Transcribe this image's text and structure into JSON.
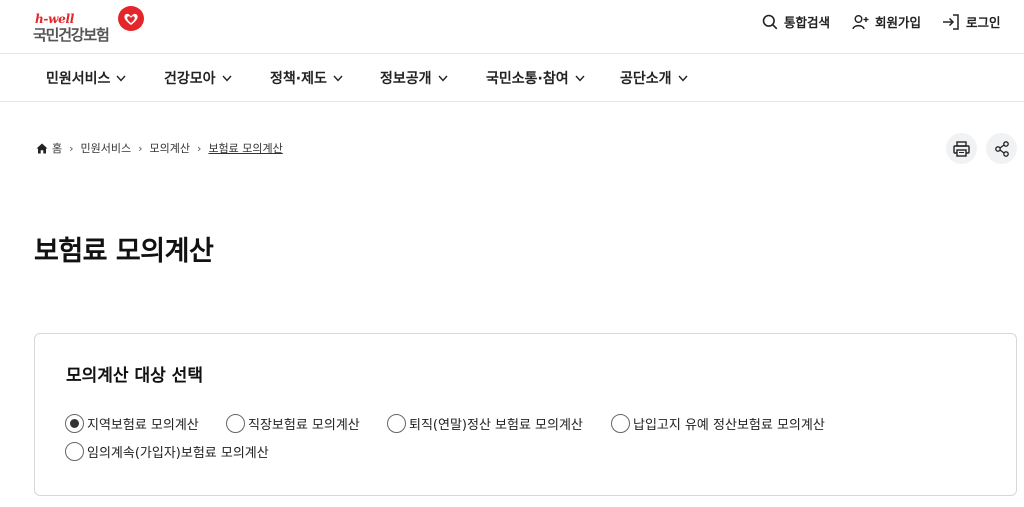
{
  "header": {
    "logo_tagline": "h-well",
    "logo_name": "국민건강보험",
    "search_label": "통합검색",
    "join_label": "회원가입",
    "login_label": "로그인"
  },
  "nav": {
    "items": [
      {
        "label": "민원서비스"
      },
      {
        "label": "건강모아"
      },
      {
        "label": "정책·제도"
      },
      {
        "label": "정보공개"
      },
      {
        "label": "국민소통·참여"
      },
      {
        "label": "공단소개"
      }
    ]
  },
  "breadcrumb": {
    "home": "홈",
    "level1": "민원서비스",
    "level2": "모의계산",
    "current": "보험료 모의계산"
  },
  "page": {
    "title": "보험료 모의계산"
  },
  "selection": {
    "title": "모의계산 대상 선택",
    "options": [
      {
        "label": "지역보험료 모의계산",
        "checked": true
      },
      {
        "label": "직장보험료 모의계산",
        "checked": false
      },
      {
        "label": "퇴직(연말)정산 보험료 모의계산",
        "checked": false
      },
      {
        "label": "납입고지 유예 정산보험료 모의계산",
        "checked": false
      },
      {
        "label": "임의계속(가입자)보험료 모의계산",
        "checked": false
      }
    ]
  },
  "colors": {
    "brand_red": "#e4262a",
    "border": "#d8d8d8"
  }
}
